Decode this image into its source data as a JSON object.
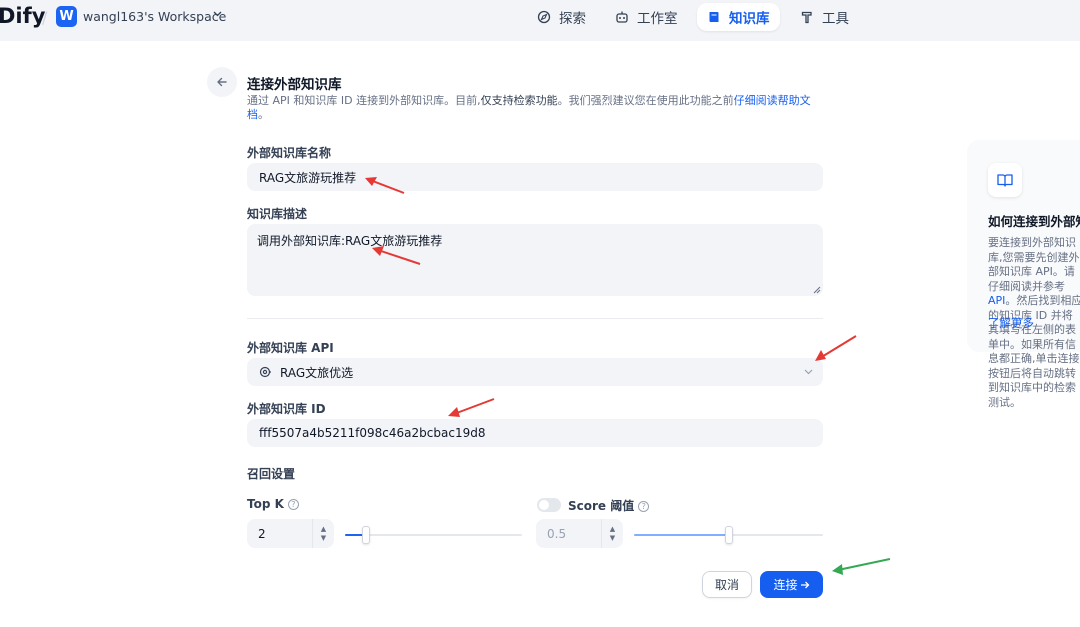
{
  "app": {
    "logo": "Dify",
    "workspace_initial": "W",
    "workspace_name": "wangl163's Workspace",
    "accent": "#155eef"
  },
  "nav": {
    "items": [
      {
        "label": "探索",
        "icon": "compass-icon"
      },
      {
        "label": "工作室",
        "icon": "robot-icon"
      },
      {
        "label": "知识库",
        "icon": "book-icon",
        "active": true
      },
      {
        "label": "工具",
        "icon": "hammer-icon"
      }
    ]
  },
  "page": {
    "title": "连接外部知识库",
    "description_1": "通过 API 和知识库 ID 连接到外部知识库。目前,",
    "description_bold": "仅支持检索功能",
    "description_2": "。我们强烈建议您在使用此功能之前",
    "description_link": "仔细阅读帮助文档",
    "description_end": "。"
  },
  "form": {
    "name_label": "外部知识库名称",
    "name_value": "RAG文旅游玩推荐",
    "desc_label": "知识库描述",
    "desc_value": "调用外部知识库:RAG文旅游玩推荐",
    "api_label": "外部知识库 API",
    "api_value": "RAG文旅优选",
    "id_label": "外部知识库 ID",
    "id_value": "fff5507a4b5211f098c46a2bcbac19d8",
    "recall_label": "召回设置",
    "topk_label": "Top K",
    "topk_value": "2",
    "topk_level": 0.12,
    "score_label": "Score 阈值",
    "score_value": "0.5",
    "score_level": 0.5,
    "score_enabled": false
  },
  "buttons": {
    "cancel": "取消",
    "connect": "连接"
  },
  "help_card": {
    "title": "如何连接到外部知识库",
    "text_1": "要连接到外部知识库,您需要先创建外部知识库 API。请仔细阅读并参考",
    "text_link": "API",
    "text_2": "。然后找到相应的知识库 ID 并将其填写在左侧的表单中。如果所有信息都正确,单击连接按钮后将自动跳转到知识库中的检索测试。",
    "more": "了解更多"
  }
}
